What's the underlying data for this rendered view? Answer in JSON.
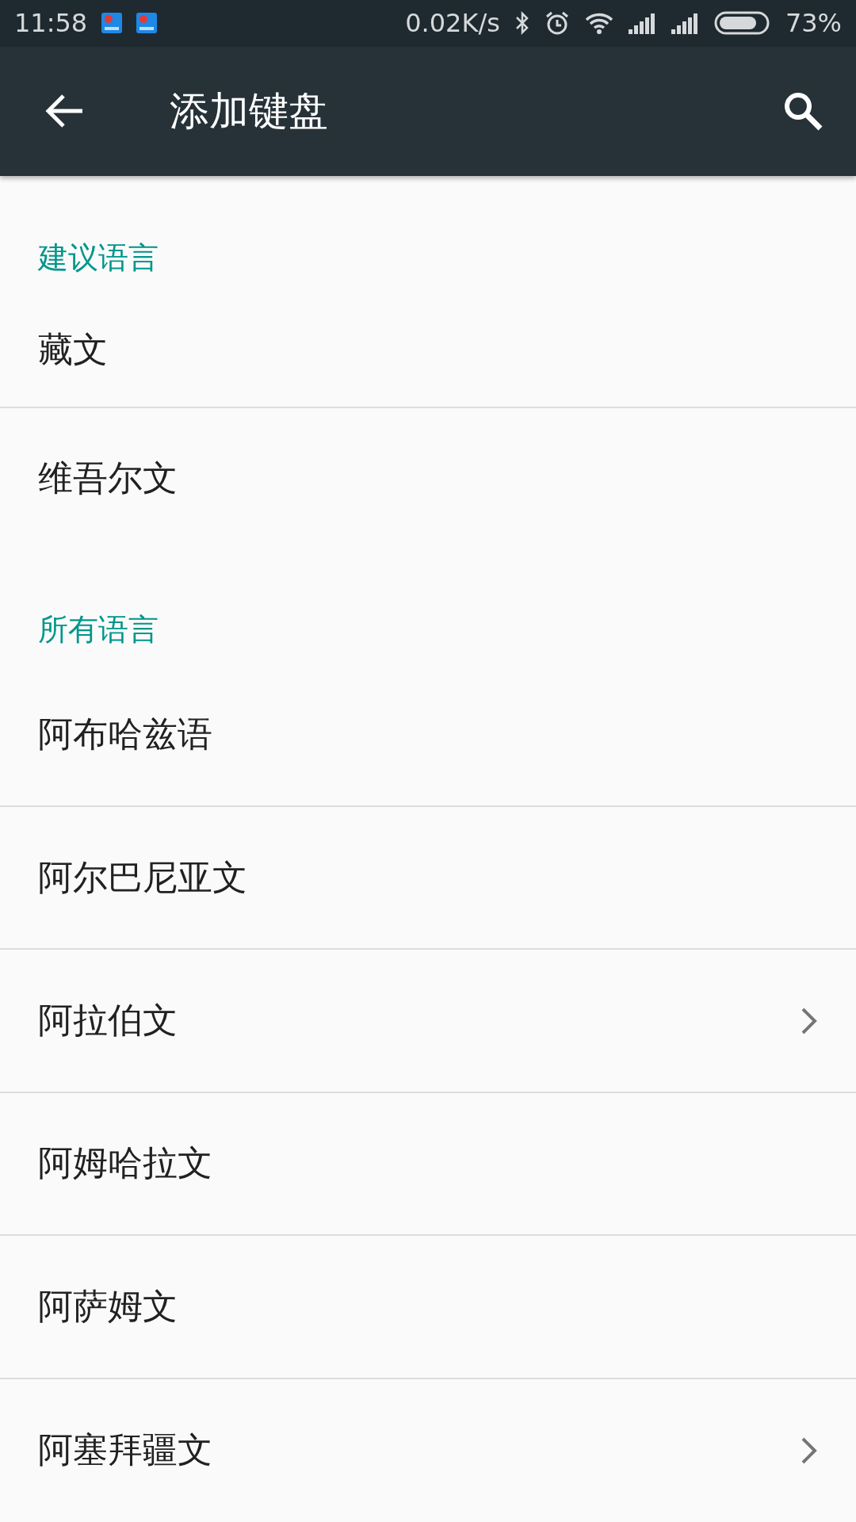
{
  "status_bar": {
    "time": "11:58",
    "speed": "0.02K/s",
    "battery": "73%"
  },
  "app_bar": {
    "title": "添加键盘"
  },
  "sections": [
    {
      "header": "建议语言",
      "items": [
        {
          "label": "藏文",
          "has_submenu": false
        },
        {
          "label": "维吾尔文",
          "has_submenu": false
        }
      ]
    },
    {
      "header": "所有语言",
      "items": [
        {
          "label": "阿布哈兹语",
          "has_submenu": false
        },
        {
          "label": "阿尔巴尼亚文",
          "has_submenu": false
        },
        {
          "label": "阿拉伯文",
          "has_submenu": true
        },
        {
          "label": "阿姆哈拉文",
          "has_submenu": false
        },
        {
          "label": "阿萨姆文",
          "has_submenu": false
        },
        {
          "label": "阿塞拜疆文",
          "has_submenu": true
        }
      ]
    }
  ]
}
